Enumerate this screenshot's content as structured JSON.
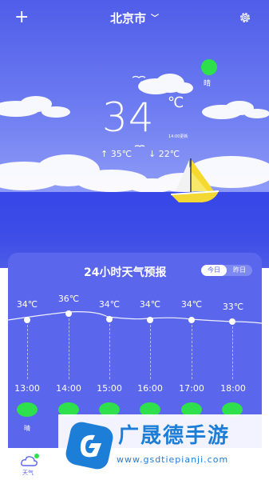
{
  "header": {
    "add_icon": "plus-icon",
    "city": "北京市",
    "settings_icon": "gear-icon"
  },
  "current": {
    "condition": "晴",
    "temperature": "34",
    "unit": "℃",
    "updated": "14:00更新",
    "high": "35℃",
    "low": "22℃"
  },
  "forecast": {
    "title": "24小时天气预报",
    "toggle": [
      "今日",
      "昨日"
    ],
    "hours": [
      {
        "temp": "34℃",
        "time": "13:00",
        "cond": "晴"
      },
      {
        "temp": "36℃",
        "time": "14:00",
        "cond": ""
      },
      {
        "temp": "34℃",
        "time": "15:00",
        "cond": ""
      },
      {
        "temp": "34℃",
        "time": "16:00",
        "cond": ""
      },
      {
        "temp": "34℃",
        "time": "17:00",
        "cond": ""
      },
      {
        "temp": "33℃",
        "time": "18:00",
        "cond": ""
      }
    ]
  },
  "tabbar": {
    "weather_label": "天气"
  },
  "watermark": {
    "title": "广晟德手游",
    "url": "www.gsdtiepianji.com"
  },
  "colors": {
    "accent": "#5a66ec",
    "sun": "#2ee04b"
  }
}
